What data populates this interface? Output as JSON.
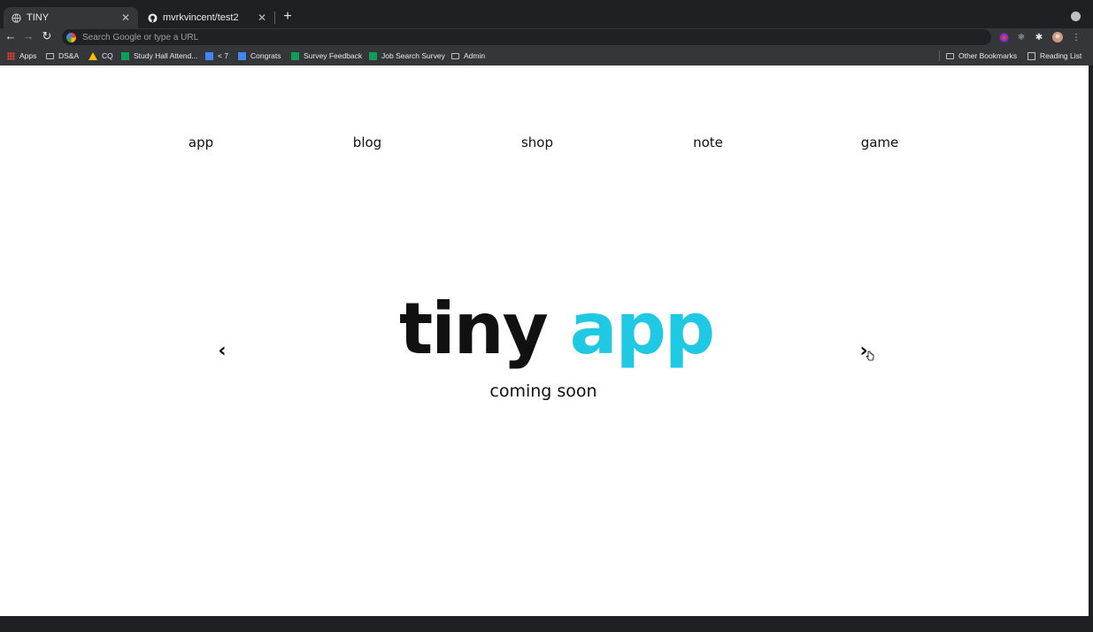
{
  "browser": {
    "tabs": [
      {
        "title": "TINY",
        "favicon": "globe-icon",
        "active": true
      },
      {
        "title": "mvrkvincent/test2",
        "favicon": "github-icon",
        "active": false
      }
    ],
    "omnibox_placeholder": "Search Google or type a URL",
    "bookmarks": [
      {
        "label": "Apps",
        "icon": "apps-icon"
      },
      {
        "label": "DS&A",
        "icon": "folder-icon"
      },
      {
        "label": "CQ",
        "icon": "drive-icon"
      },
      {
        "label": "Study Hall Attend...",
        "icon": "sheets-icon"
      },
      {
        "label": "< 7",
        "icon": "docs-icon"
      },
      {
        "label": "Congrats",
        "icon": "docs-icon"
      },
      {
        "label": "Survey Feedback",
        "icon": "sheets-icon"
      },
      {
        "label": "Job Search Survey",
        "icon": "sheets-icon"
      },
      {
        "label": "Admin",
        "icon": "folder-icon"
      }
    ],
    "other_bookmarks": "Other Bookmarks",
    "reading_list": "Reading List"
  },
  "page": {
    "nav": [
      "app",
      "blog",
      "shop",
      "note",
      "game"
    ],
    "hero": {
      "word1": "tiny",
      "word2": "app",
      "subtitle": "coming soon"
    },
    "accent_color": "#1fc8e3"
  }
}
